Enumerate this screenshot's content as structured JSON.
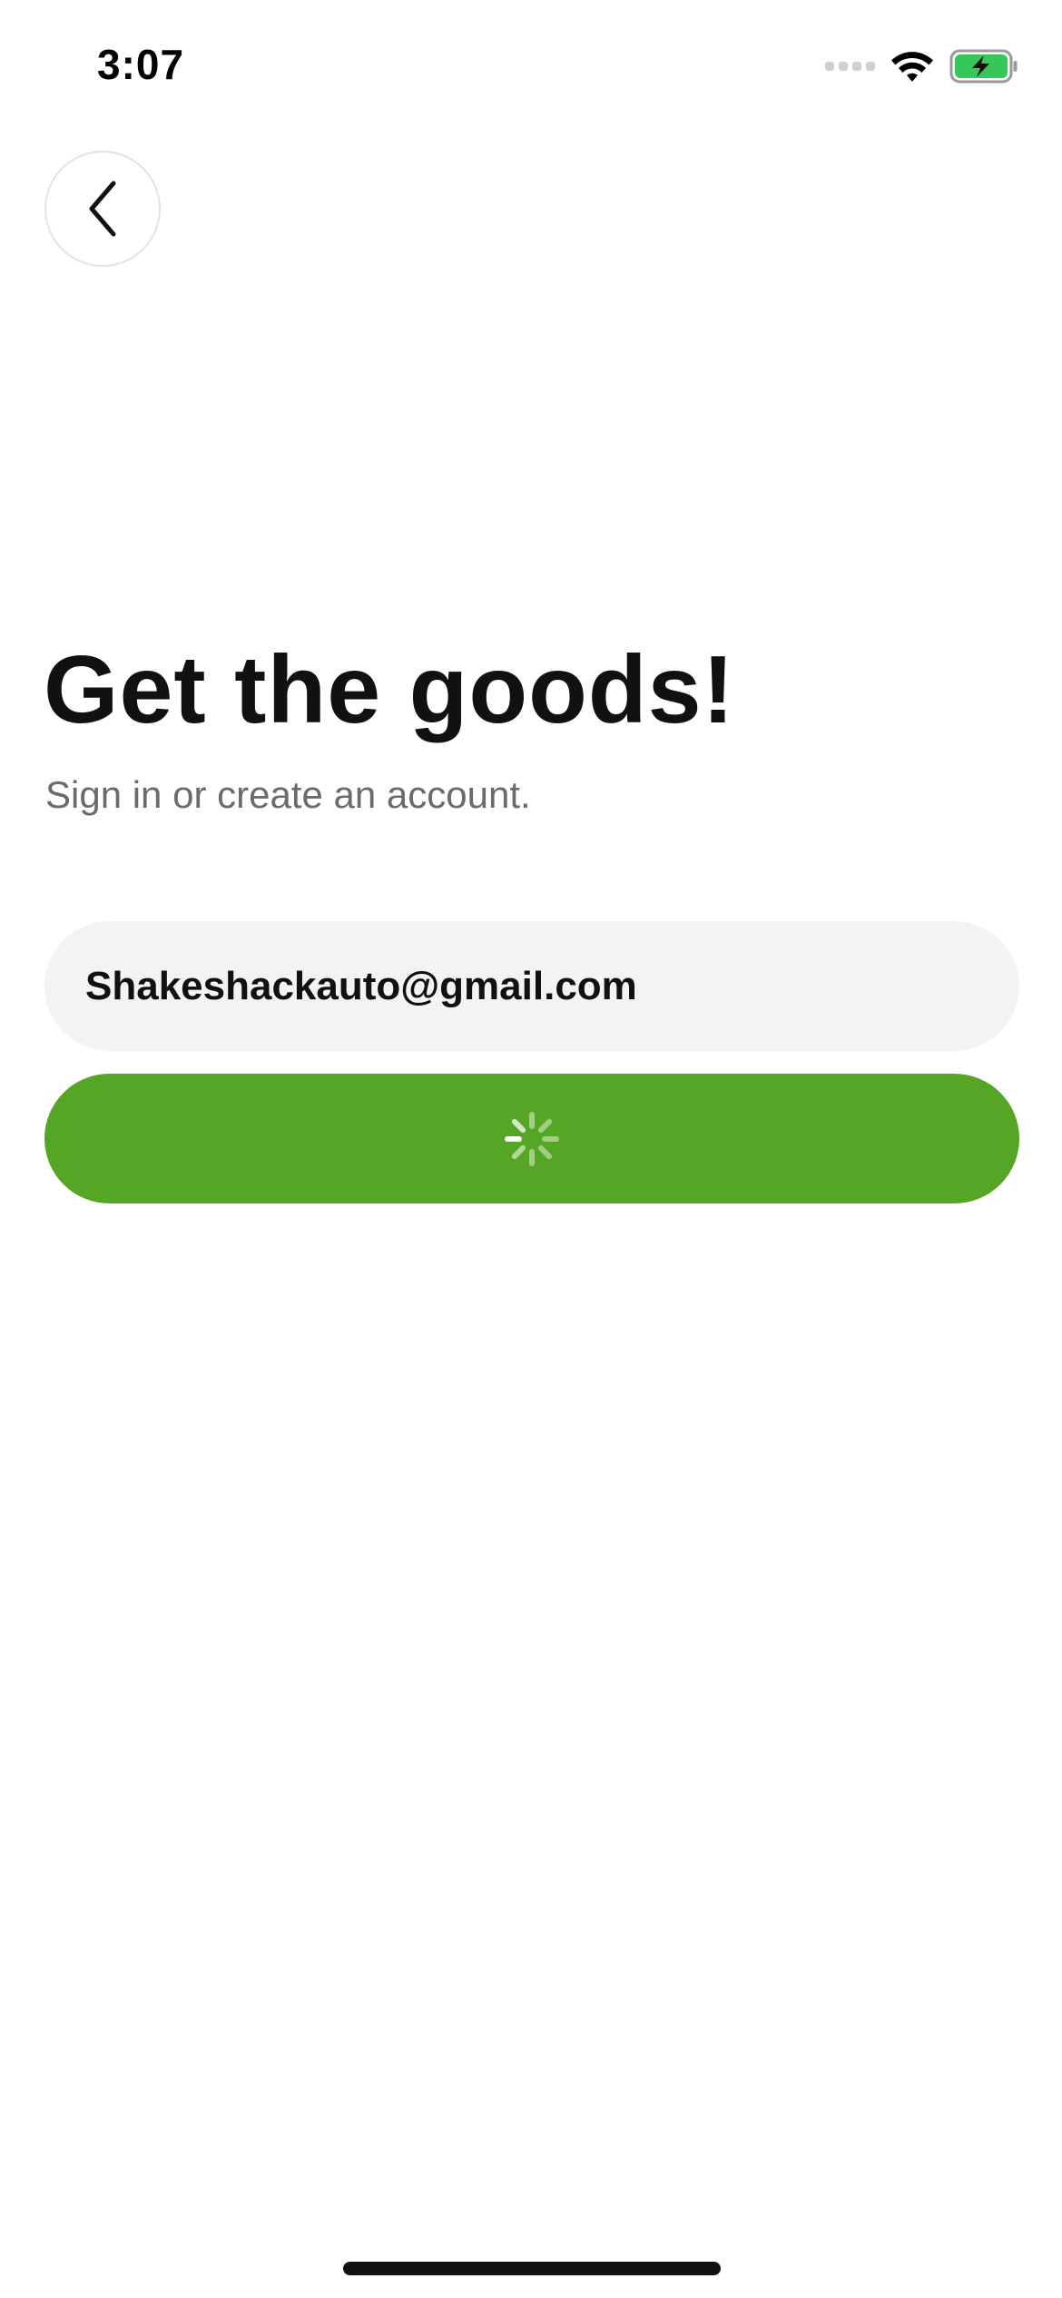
{
  "status_bar": {
    "time": "3:07",
    "icons": [
      "cellular-signal-icon",
      "wifi-icon",
      "battery-charging-icon"
    ]
  },
  "back_button": {
    "icon": "chevron-left-icon"
  },
  "header": {
    "title": "Get the goods!",
    "subtitle": "Sign in or create an account."
  },
  "form": {
    "email_value": "Shakeshackauto@gmail.com",
    "submit_button": {
      "state": "loading",
      "icon": "loading-spinner-icon"
    }
  },
  "colors": {
    "accent_green": "#55a624",
    "input_background": "#f3f3f3",
    "battery_green": "#35c759",
    "title_text": "#111111",
    "subtitle_text": "#6b6b6b"
  }
}
